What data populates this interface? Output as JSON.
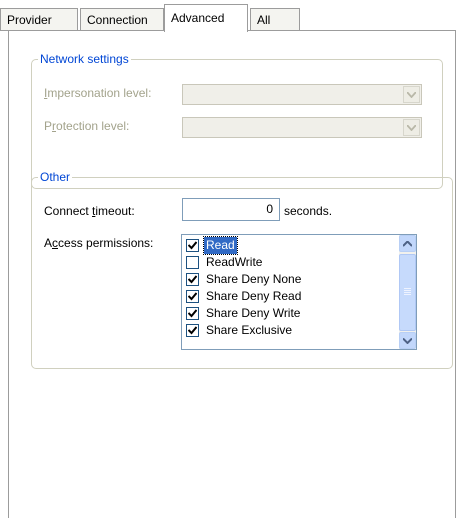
{
  "tabs": [
    {
      "label": "Provider"
    },
    {
      "label": "Connection"
    },
    {
      "label": "Advanced"
    },
    {
      "label": "All"
    }
  ],
  "network_settings": {
    "legend": "Network settings",
    "impersonation_label": "Impersonation level:",
    "impersonation_value": "",
    "protection_label": "Protection level:",
    "protection_value": ""
  },
  "other": {
    "legend": "Other",
    "timeout_label": "Connect timeout:",
    "timeout_value": "0",
    "timeout_unit": "seconds.",
    "access_label": "Access permissions:",
    "permissions": [
      {
        "label": "Read",
        "checked": true,
        "selected": true
      },
      {
        "label": "ReadWrite",
        "checked": false,
        "selected": false
      },
      {
        "label": "Share Deny None",
        "checked": true,
        "selected": false
      },
      {
        "label": "Share Deny Read",
        "checked": true,
        "selected": false
      },
      {
        "label": "Share Deny Write",
        "checked": true,
        "selected": false
      },
      {
        "label": "Share Exclusive",
        "checked": true,
        "selected": false
      }
    ]
  },
  "colors": {
    "legend": "#0046d5",
    "selection": "#316ac5",
    "disabled_text": "#a3a38c"
  }
}
